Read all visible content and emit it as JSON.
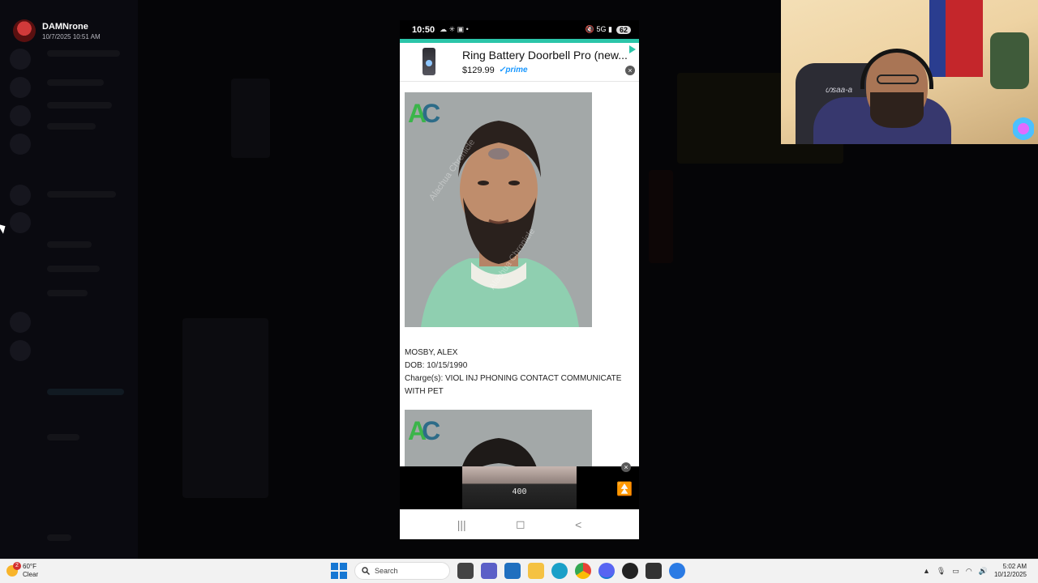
{
  "presenter": {
    "name": "DAMNrone",
    "timestamp": "10/7/2025 10:51 AM"
  },
  "phone": {
    "status": {
      "time": "10:50",
      "left_icons": "☁ ✳ ▣ •",
      "right_icons": "🔇 5G ▮",
      "battery": "62"
    },
    "ad": {
      "title": "Ring Battery Doorbell Pro (new...",
      "price": "$129.99",
      "prime": "✓prime",
      "close": "×"
    },
    "article": {
      "logo_a": "A",
      "logo_c": "C",
      "watermark": "Alachua Chronicle",
      "records": [
        {
          "name": "MOSBY, ALEX",
          "dob": "DOB: 10/15/1990",
          "charges": "Charge(s): VIOL INJ PHONING CONTACT COMMUNICATE WITH PET"
        }
      ]
    },
    "bottom_ad": {
      "display": "400",
      "close": "×",
      "scroll_up": "⏫"
    },
    "nav": {
      "recents": "|||",
      "home": "◻",
      "back": "<"
    }
  },
  "webcam": {
    "chair_text": "ഗsaa-a"
  },
  "taskbar": {
    "weather": {
      "badge": "2",
      "temp": "60°F",
      "condition": "Clear"
    },
    "search_placeholder": "Search",
    "clock": {
      "time": "5:02 AM",
      "date": "10/12/2025"
    },
    "apps": [
      "windows-start",
      "search",
      "copilot",
      "file-explorer",
      "teams",
      "store",
      "folder",
      "edge",
      "chrome",
      "discord",
      "obs",
      "app-n",
      "app-blue"
    ],
    "accent_colors": {
      "phone_accent": "#2bc5a9",
      "windows_blue": "#1677d3"
    }
  }
}
